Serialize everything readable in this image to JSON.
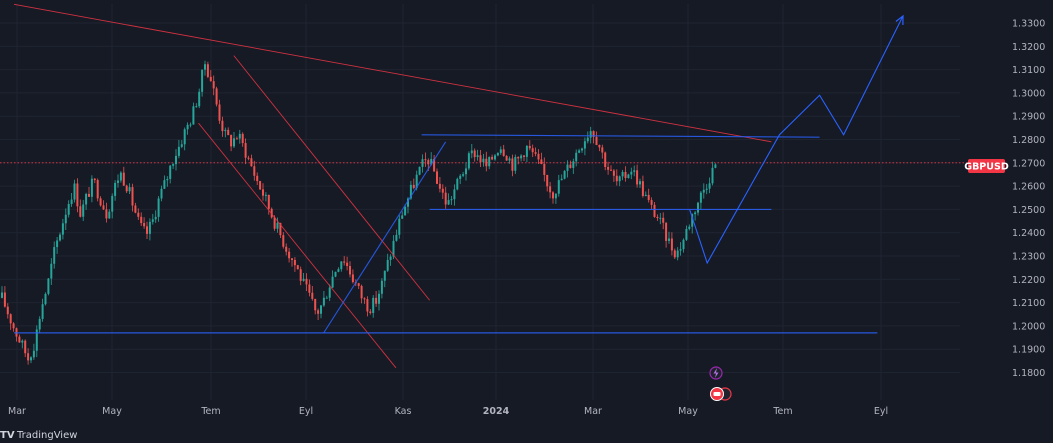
{
  "chart_data": {
    "type": "candlestick",
    "symbol": "GBPUSD",
    "last_price": 1.27,
    "ylim": [
      1.175,
      1.338
    ],
    "y_ticks": [
      "1.3300",
      "1.3200",
      "1.3100",
      "1.3000",
      "1.2900",
      "1.2800",
      "1.2700",
      "1.2600",
      "1.2500",
      "1.2400",
      "1.2300",
      "1.2200",
      "1.2100",
      "1.2000",
      "1.1900",
      "1.1800"
    ],
    "x_ticks": [
      "Mar",
      "May",
      "Tem",
      "Eyl",
      "Kas",
      "2024",
      "Mar",
      "May",
      "Tem",
      "Eyl"
    ],
    "x_tick_bold": [
      false,
      false,
      false,
      false,
      false,
      true,
      false,
      false,
      false,
      false
    ],
    "grid": true,
    "colors": {
      "up": "#26a69a",
      "down": "#ef5350",
      "drawing_blue": "#2962ff",
      "drawing_red": "#f23645",
      "tag": "#f23645"
    },
    "close_series": [
      1.212,
      1.205,
      1.198,
      1.192,
      1.186,
      1.193,
      1.208,
      1.218,
      1.232,
      1.242,
      1.252,
      1.26,
      1.248,
      1.256,
      1.262,
      1.255,
      1.248,
      1.258,
      1.266,
      1.261,
      1.252,
      1.243,
      1.239,
      1.245,
      1.255,
      1.262,
      1.271,
      1.277,
      1.284,
      1.29,
      1.3,
      1.313,
      1.305,
      1.292,
      1.282,
      1.279,
      1.282,
      1.276,
      1.269,
      1.262,
      1.256,
      1.249,
      1.242,
      1.236,
      1.23,
      1.225,
      1.218,
      1.212,
      1.205,
      1.21,
      1.218,
      1.225,
      1.23,
      1.224,
      1.218,
      1.212,
      1.208,
      1.21,
      1.218,
      1.228,
      1.238,
      1.248,
      1.255,
      1.262,
      1.268,
      1.272,
      1.266,
      1.258,
      1.252,
      1.258,
      1.264,
      1.27,
      1.275,
      1.272,
      1.268,
      1.273,
      1.278,
      1.274,
      1.269,
      1.272,
      1.277,
      1.274,
      1.269,
      1.263,
      1.257,
      1.261,
      1.266,
      1.271,
      1.276,
      1.281,
      1.285,
      1.279,
      1.271,
      1.265,
      1.261,
      1.264,
      1.268,
      1.263,
      1.257,
      1.251,
      1.247,
      1.241,
      1.235,
      1.231,
      1.237,
      1.245,
      1.252,
      1.258,
      1.264,
      1.27
    ],
    "trendlines": {
      "descending_resistance": [
        [
          "2023-03-01",
          1.338
        ],
        [
          "2024-06-15",
          1.279
        ]
      ],
      "channel_upper": [
        [
          "2023-07-16",
          1.316
        ],
        [
          "2023-11-15",
          1.211
        ]
      ],
      "channel_lower": [
        [
          "2023-06-24",
          1.287
        ],
        [
          "2023-10-25",
          1.182
        ]
      ],
      "range_top": [
        [
          "2023-11-10",
          1.282
        ],
        [
          "2024-07-15",
          1.281
        ]
      ],
      "range_bottom": [
        [
          "2023-11-15",
          1.25
        ],
        [
          "2024-06-15",
          1.25
        ]
      ],
      "support": [
        [
          "2023-03-01",
          1.197
        ],
        [
          "2024-08-20",
          1.197
        ]
      ],
      "rising_channel_line": [
        [
          "2023-09-10",
          1.197
        ],
        [
          "2023-11-25",
          1.279
        ]
      ],
      "projection_path": [
        [
          "2024-04-25",
          1.25
        ],
        [
          "2024-05-06",
          1.227
        ],
        [
          "2024-06-20",
          1.282
        ],
        [
          "2024-07-15",
          1.299
        ],
        [
          "2024-07-30",
          1.282
        ],
        [
          "2024-09-05",
          1.333
        ]
      ]
    }
  },
  "footer": {
    "brand": "TradingView",
    "logo_text": "TV"
  }
}
